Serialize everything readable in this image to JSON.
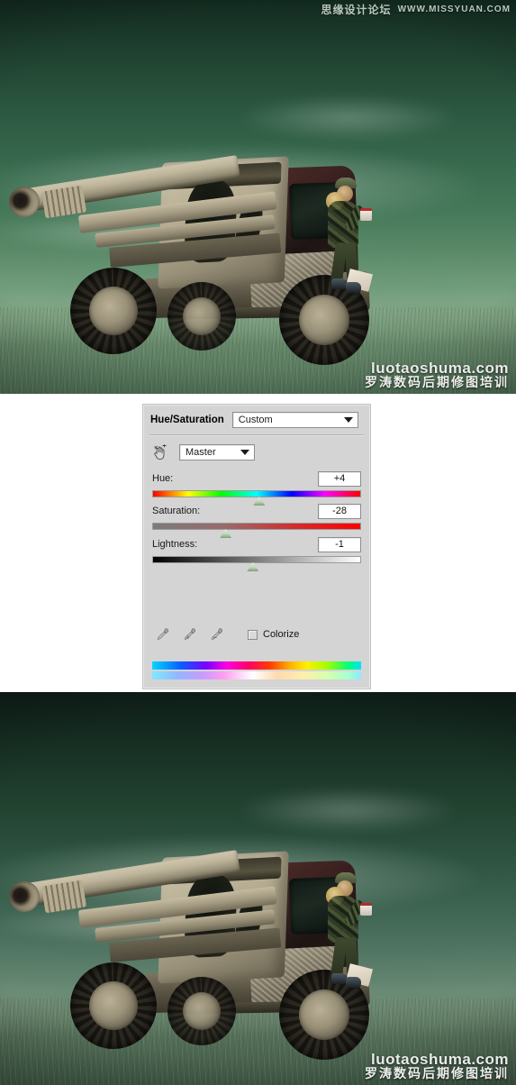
{
  "watermark": {
    "top_cn": "思缘设计论坛",
    "top_en": "WWW.MISSYUAN.COM",
    "brand_en": "luotaoshuma.com",
    "brand_cn": "罗涛数码后期修图培训"
  },
  "dialog": {
    "title": "Hue/Saturation",
    "preset": "Custom",
    "preset_caret_icon": "chevron-down-icon",
    "hand_icon": "on-image-adjust-hand-icon",
    "channel": "Master",
    "channel_caret_icon": "chevron-down-icon",
    "sliders": [
      {
        "label": "Hue:",
        "value": "+4",
        "thumb_pct": 51
      },
      {
        "label": "Saturation:",
        "value": "-28",
        "thumb_pct": 35
      },
      {
        "label": "Lightness:",
        "value": "-1",
        "thumb_pct": 48
      }
    ],
    "eyedroppers": [
      "eyedropper-icon",
      "eyedropper-add-icon",
      "eyedropper-subtract-icon"
    ],
    "colorize_label": "Colorize",
    "colorize_checked": false,
    "colors": {
      "panel_bg": "#d4d4d4",
      "field_bg": "#ffffff",
      "field_border": "#8e8e8e",
      "thumb": "#c2d6bb"
    }
  },
  "photos": {
    "before": {
      "caption": "military artillery vehicle composite - before hue/saturation",
      "sky_color": "#2d5a42",
      "ground_color": "#5c7e60"
    },
    "after": {
      "caption": "military artillery vehicle composite - after hue/saturation",
      "sky_color": "#234331",
      "ground_color": "#4c6650"
    }
  }
}
